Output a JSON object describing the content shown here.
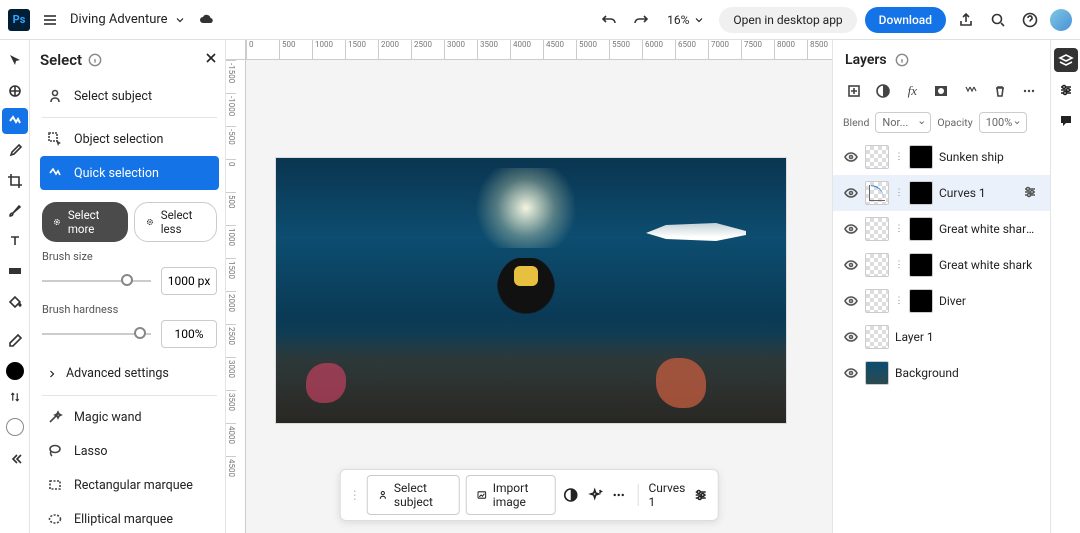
{
  "header": {
    "doc_title": "Diving Adventure",
    "zoom": "16%",
    "open_desktop": "Open in desktop app",
    "download": "Download"
  },
  "select_panel": {
    "title": "Select",
    "items": {
      "select_subject": "Select subject",
      "object_selection": "Object selection",
      "quick_selection": "Quick selection",
      "magic_wand": "Magic wand",
      "lasso": "Lasso",
      "rect_marquee": "Rectangular marquee",
      "ellip_marquee": "Elliptical marquee"
    },
    "qs": {
      "select_more": "Select more",
      "select_less": "Select less",
      "brush_size_label": "Brush size",
      "brush_size_value": "1000 px",
      "brush_hardness_label": "Brush hardness",
      "brush_hardness_value": "100%",
      "advanced": "Advanced settings"
    }
  },
  "ruler_h": [
    "0",
    "500",
    "1000",
    "1500",
    "2000",
    "2500",
    "3000",
    "3500",
    "4000",
    "4500",
    "5000",
    "5500",
    "6000",
    "6500",
    "7000",
    "7500",
    "8000",
    "8500"
  ],
  "ruler_v": [
    "-1500",
    "-1000",
    "-500",
    "0",
    "500",
    "1000",
    "1500",
    "2000",
    "2500",
    "3000",
    "3500",
    "4000",
    "4500"
  ],
  "bottom_bar": {
    "select_subject": "Select subject",
    "import_image": "Import image",
    "curves": "Curves 1"
  },
  "layers_panel": {
    "title": "Layers",
    "blend_label": "Blend",
    "blend_value": "Nor...",
    "opacity_label": "Opacity",
    "opacity_value": "100%",
    "layers": [
      {
        "name": "Sunken ship",
        "eye": true,
        "thumb": "checker",
        "mask": "black"
      },
      {
        "name": "Curves 1",
        "eye": true,
        "thumb": "curves",
        "mask": "black",
        "selected": true,
        "adjust": true
      },
      {
        "name": "Great white shark co...",
        "eye": true,
        "thumb": "checker",
        "mask": "black"
      },
      {
        "name": "Great white shark",
        "eye": true,
        "thumb": "checker",
        "mask": "black"
      },
      {
        "name": "Diver",
        "eye": true,
        "thumb": "checker",
        "mask": "black"
      },
      {
        "name": "Layer 1",
        "eye": true,
        "thumb": "checker"
      },
      {
        "name": "Background",
        "eye": true,
        "thumb": "img"
      }
    ]
  }
}
